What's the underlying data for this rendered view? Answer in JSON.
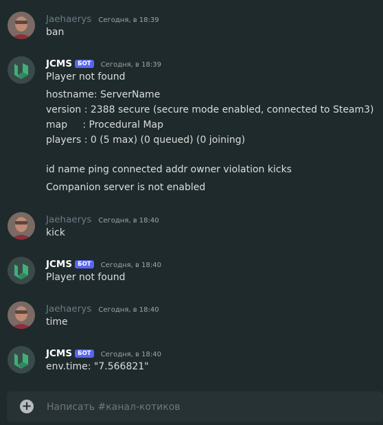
{
  "messages": [
    {
      "author": "Jaehaerys",
      "bot": false,
      "time": "Сегодня, в 18:39",
      "lines": [
        "ban"
      ]
    },
    {
      "author": "JCMS",
      "bot": true,
      "badge": "БОТ",
      "time": "Сегодня, в 18:39",
      "lines": [
        "Player not found",
        "hostname: ServerName",
        "version : 2388 secure (secure mode enabled, connected to Steam3)",
        "map     : Procedural Map",
        "players : 0 (5 max) (0 queued) (0 joining)",
        "id name ping connected addr owner violation kicks",
        "Companion server is not enabled"
      ]
    },
    {
      "author": "Jaehaerys",
      "bot": false,
      "time": "Сегодня, в 18:40",
      "lines": [
        "kick"
      ]
    },
    {
      "author": "JCMS",
      "bot": true,
      "badge": "БОТ",
      "time": "Сегодня, в 18:40",
      "lines": [
        "Player not found"
      ]
    },
    {
      "author": "Jaehaerys",
      "bot": false,
      "time": "Сегодня, в 18:40",
      "lines": [
        "time"
      ]
    },
    {
      "author": "JCMS",
      "bot": true,
      "badge": "БОТ",
      "time": "Сегодня, в 18:40",
      "lines": [
        "env.time: \"7.566821\""
      ]
    }
  ],
  "composer": {
    "placeholder": "Написать #канал-котиков",
    "value": ""
  },
  "colors": {
    "background": "#1e2a2b",
    "bot_badge": "#5865f2",
    "user_name": "#6c7b87"
  }
}
